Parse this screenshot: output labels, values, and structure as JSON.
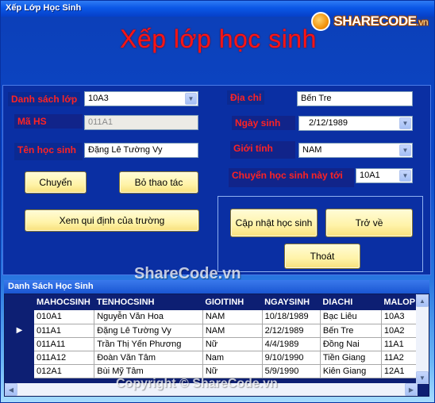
{
  "window": {
    "title": "Xếp Lớp Học Sinh"
  },
  "brand": {
    "logo_text": "SHARECODE",
    "logo_suffix": ".vn"
  },
  "header": {
    "title": "Xếp lớp học sinh"
  },
  "form": {
    "class_list_label": "Danh sách lớp",
    "class_list_value": "10A3",
    "student_id_label": "Mã HS",
    "student_id_value": "011A1",
    "student_name_label": "Tên học sinh",
    "student_name_value": "Đặng Lê Tường Vy",
    "address_label": "Địa chỉ",
    "address_value": "Bến Tre",
    "birthdate_label": "Ngày sinh",
    "birthdate_value": "2/12/1989",
    "gender_label": "Giới tính",
    "gender_value": "NAM",
    "move_to_label": "Chuyển học sinh này tới",
    "move_to_value": "10A1"
  },
  "buttons": {
    "transfer": "Chuyển",
    "cancel": "Bỏ thao tác",
    "rules": "Xem qui định của trường",
    "update": "Cập nhật học sinh",
    "back": "Trở về",
    "exit": "Thoát"
  },
  "grid": {
    "title": "Danh Sách Học Sinh",
    "columns": [
      "MAHOCSINH",
      "TENHOCSINH",
      "GIOITINH",
      "NGAYSINH",
      "DIACHI",
      "MALOP"
    ],
    "rows": [
      [
        "010A1",
        "Nguyễn Văn Hoa",
        "NAM",
        "10/18/1989",
        "Bạc Liêu",
        "10A3"
      ],
      [
        "011A1",
        "Đặng Lê Tường Vy",
        "NAM",
        "2/12/1989",
        "Bến Tre",
        "10A2"
      ],
      [
        "011A11",
        "Trần Thị Yến Phương",
        "Nữ",
        "4/4/1989",
        "Đồng Nai",
        "11A1"
      ],
      [
        "011A12",
        "Đoàn Văn Tâm",
        "Nam",
        "9/10/1990",
        "Tiền Giang",
        "11A2"
      ],
      [
        "012A1",
        "Bùi Mỹ Tâm",
        "Nữ",
        "5/9/1990",
        "Kiên Giang",
        "12A1"
      ]
    ],
    "current_row_marker": "▶"
  },
  "watermarks": {
    "center": "ShareCode.vn",
    "bottom": "Copyright © ShareCode.vn"
  },
  "colors": {
    "label_red": "#ff2323",
    "title_red": "#ff1414",
    "button_yellow": "#fff3a8",
    "panel_blue": "#0a2fa3"
  }
}
